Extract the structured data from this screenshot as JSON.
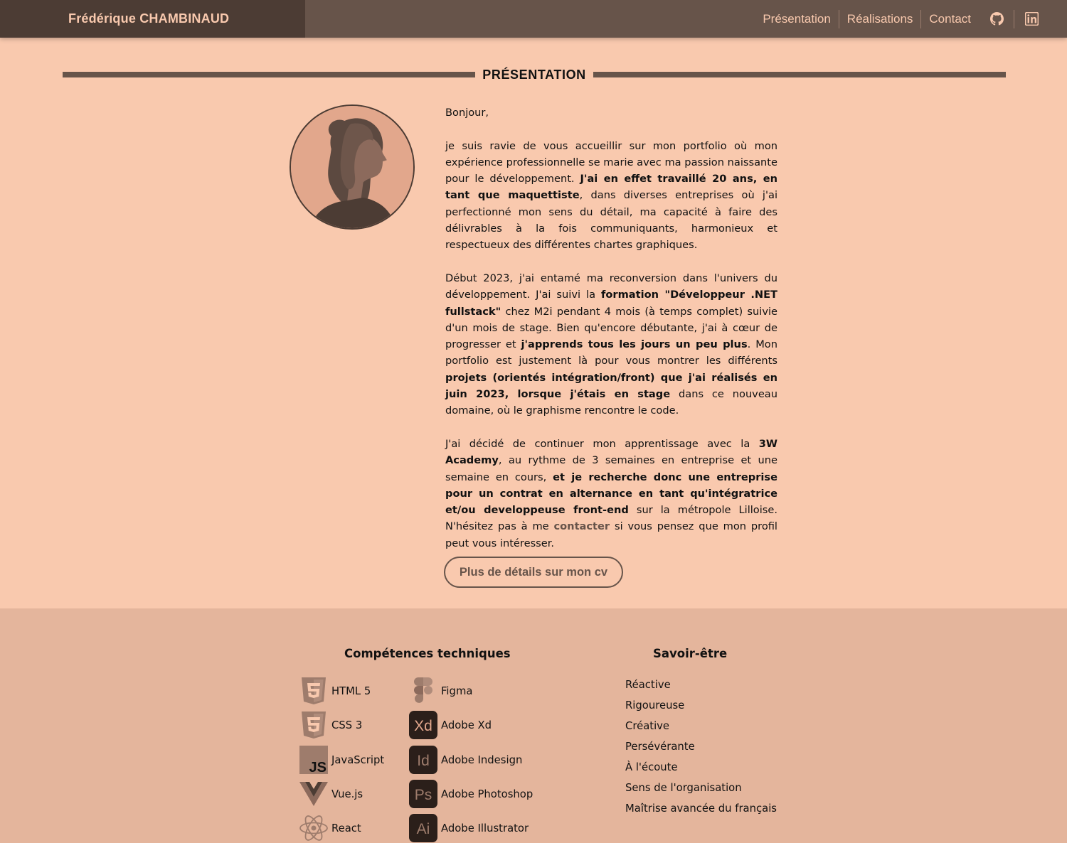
{
  "header": {
    "brand": "Frédérique CHAMBINAUD",
    "nav": [
      {
        "label": "Présentation"
      },
      {
        "label": "Réalisations"
      },
      {
        "label": "Contact"
      }
    ],
    "icons": [
      "github-icon",
      "linkedin-icon"
    ]
  },
  "section": {
    "title": "PRÉSENTATION"
  },
  "bio": {
    "greeting": "Bonjour,",
    "p1_a": "je suis ravie de vous accueillir sur mon portfolio où mon expérience professionnelle se marie avec ma passion naissante pour le développement. ",
    "p1_b": "J'ai en effet travaillé 20 ans, en tant que maquettiste",
    "p1_c": ", dans diverses entreprises où j'ai perfectionné mon sens du détail, ma capacité à faire des délivrables à la fois communiquants, harmonieux et respectueux des différentes chartes graphiques.",
    "p2_a": "Début 2023, j'ai entamé ma reconversion dans l'univers du développement. J'ai suivi la ",
    "p2_b": "formation \"Développeur .NET fullstack\"",
    "p2_c": " chez M2i pendant 4 mois (à temps complet) suivie d'un mois de stage. Bien qu'encore débutante, j'ai à cœur de progresser et ",
    "p2_d": "j'apprends tous les jours un peu plus",
    "p2_e": ". Mon portfolio est justement là pour vous montrer les différents ",
    "p2_f": "projets (orientés intégration/front) que j'ai réalisés en juin 2023, lorsque j'étais en stage",
    "p2_g": " dans ce nouveau domaine, où le graphisme rencontre le code.",
    "p3_a": "J'ai décidé de continuer mon apprentissage avec la ",
    "p3_b": "3W Academy",
    "p3_c": ", au rythme de 3 semaines en entreprise et une semaine en cours, ",
    "p3_d": "et je recherche donc une entreprise pour un contrat en alternance en tant qu'intégratrice et/ou developpeuse front-end",
    "p3_e": " sur la métropole Lilloise. N'hésitez pas à me ",
    "p3_link": "contacter",
    "p3_f": " si vous pensez que mon profil peut vous intéresser."
  },
  "cv_button": "Plus de détails sur mon cv",
  "skills": {
    "tech_title": "Compétences techniques",
    "tech_col1": [
      {
        "label": "HTML 5",
        "icon": "html5-icon"
      },
      {
        "label": "CSS 3",
        "icon": "css3-icon"
      },
      {
        "label": "JavaScript",
        "icon": "javascript-icon"
      },
      {
        "label": "Vue.js",
        "icon": "vuejs-icon"
      },
      {
        "label": "React",
        "icon": "react-icon"
      }
    ],
    "tech_col2": [
      {
        "label": "Figma",
        "icon": "figma-icon"
      },
      {
        "label": "Adobe Xd",
        "icon": "adobe-xd-icon",
        "badge": "Xd"
      },
      {
        "label": "Adobe Indesign",
        "icon": "adobe-indesign-icon",
        "badge": "Id"
      },
      {
        "label": "Adobe Photoshop",
        "icon": "adobe-photoshop-icon",
        "badge": "Ps"
      },
      {
        "label": "Adobe Illustrator",
        "icon": "adobe-illustrator-icon",
        "badge": "Ai"
      }
    ],
    "soft_title": "Savoir-être",
    "soft": [
      "Réactive",
      "Rigoureuse",
      "Créative",
      "Persévérante",
      "À l'écoute",
      "Sens de l'organisation",
      "Maîtrise avancée du français"
    ],
    "badge_js": "JS"
  },
  "colors": {
    "background": "#f9c9ae",
    "header": "#67544a",
    "brand_bg": "#4c3c34",
    "accent": "#f9c9ae",
    "skills_bg": "#e4b59c"
  }
}
